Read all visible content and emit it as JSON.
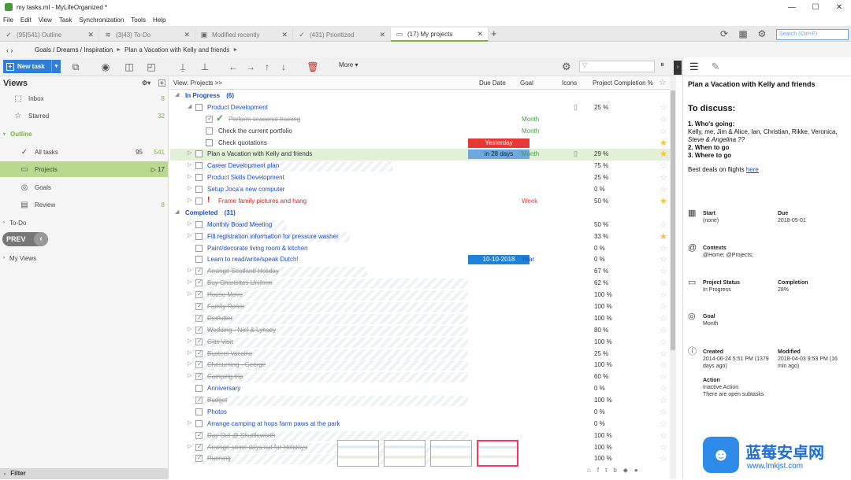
{
  "window": {
    "title": "my tasks.ml - MyLifeOrganized *",
    "buttons": [
      "—",
      "☐",
      "✕"
    ]
  },
  "menu": [
    "File",
    "Edit",
    "View",
    "Task",
    "Synchronization",
    "Tools",
    "Help"
  ],
  "tabs": [
    {
      "label": "(95|541) Outline",
      "icon": "✓"
    },
    {
      "label": "(3|43) To-Do",
      "icon": "≋"
    },
    {
      "label": "Modified recently",
      "icon": "▣"
    },
    {
      "label": "(431) Prioritized",
      "icon": "✓"
    },
    {
      "label": "(17) My projects",
      "icon": "▭"
    }
  ],
  "search": {
    "placeholder": "Search (Ctrl+F)"
  },
  "breadcrumb": {
    "items": [
      "Goals / Dreams / Inspiration",
      "Plan a Vacation with Kelly and friends"
    ]
  },
  "toolbar": {
    "new_task": "New task",
    "more": "More"
  },
  "filter": {
    "placeholder": ""
  },
  "sidebar": {
    "title": "Views",
    "inbox": {
      "label": "Inbox",
      "count": "8"
    },
    "starred": {
      "label": "Starred",
      "count": "32"
    },
    "outline": {
      "label": "Outline"
    },
    "alltasks": {
      "label": "All tasks",
      "count": "95",
      "count2": "541"
    },
    "projects": {
      "label": "Projects",
      "count": "▷ 17"
    },
    "goals": {
      "label": "Goals"
    },
    "review": {
      "label": "Review",
      "count": "8"
    },
    "todo": {
      "label": "To-Do"
    },
    "prev": "PREV",
    "myviews": {
      "label": "My Views"
    },
    "filter": "Filter"
  },
  "grid": {
    "columns": {
      "view": "View: Projects >>",
      "due": "Due Date",
      "goal": "Goal",
      "icons": "Icons",
      "completion": "Project Completion %"
    },
    "groups": {
      "inprogress": "In Progress",
      "inprogress_count": "(6)",
      "completed": "Completed",
      "completed_count": "(31)"
    },
    "rows": [
      {
        "name": "Product Development",
        "goal": "",
        "due": "",
        "pct": "25 %"
      },
      {
        "name": "Perform seasonal training",
        "goal": "Month",
        "due": "",
        "pct": ""
      },
      {
        "name": "Check the current portfolio",
        "goal": "Month",
        "due": "",
        "pct": ""
      },
      {
        "name": "Check quotations",
        "goal": "",
        "due": "Yesterday",
        "pct": ""
      },
      {
        "name": "Plan a Vacation with Kelly and friends",
        "goal": "Month",
        "due": "in 28 days",
        "pct": "29 %"
      },
      {
        "name": "Career Development plan",
        "goal": "",
        "due": "",
        "pct": "75 %"
      },
      {
        "name": "Product Skills Development",
        "goal": "",
        "due": "",
        "pct": "25 %"
      },
      {
        "name": "Setup Joca'a new computer",
        "goal": "",
        "due": "",
        "pct": "0 %"
      },
      {
        "name": "Frame family pictures and hang",
        "goal": "Week",
        "due": "",
        "pct": "50 %"
      },
      {
        "name": "Monthly Board Meeting",
        "goal": "",
        "due": "",
        "pct": "50 %"
      },
      {
        "name": "Fill registration information for pressure washer",
        "goal": "",
        "due": "",
        "pct": "33 %"
      },
      {
        "name": "Paint/decorate living room & kitchen",
        "goal": "",
        "due": "",
        "pct": "0 %"
      },
      {
        "name": "Learn to read/write/speak Dutch!",
        "goal": "Year",
        "due": "10-10-2018",
        "pct": "0 %"
      },
      {
        "name": "Arrange Scotland Holiday",
        "goal": "",
        "due": "",
        "pct": "67 %"
      },
      {
        "name": "Buy Charlottes Uniform",
        "goal": "",
        "due": "",
        "pct": "62 %"
      },
      {
        "name": "House Move",
        "goal": "",
        "due": "",
        "pct": "100 %"
      },
      {
        "name": "Family Room",
        "goal": "",
        "due": "",
        "pct": "100 %"
      },
      {
        "name": "Declutter",
        "goal": "",
        "due": "",
        "pct": "100 %"
      },
      {
        "name": "Wedding - Niel & Lynsey",
        "goal": "",
        "due": "",
        "pct": "80 %"
      },
      {
        "name": "Gills Visit",
        "goal": "",
        "due": "",
        "pct": "100 %"
      },
      {
        "name": "Busters Vaccine",
        "goal": "",
        "due": "",
        "pct": "25 %"
      },
      {
        "name": "Christening - George",
        "goal": "",
        "due": "",
        "pct": "100 %"
      },
      {
        "name": "Camping trip",
        "goal": "",
        "due": "",
        "pct": "60 %"
      },
      {
        "name": "Anniversary",
        "goal": "",
        "due": "",
        "pct": "0 %"
      },
      {
        "name": "Budget",
        "goal": "",
        "due": "",
        "pct": "100 %"
      },
      {
        "name": "Photos",
        "goal": "",
        "due": "",
        "pct": "0 %"
      },
      {
        "name": "Arrange camping at hops farm paws at the park",
        "goal": "",
        "due": "",
        "pct": "0 %"
      },
      {
        "name": "Day Out @ Shuttleworth",
        "goal": "",
        "due": "",
        "pct": "100 %"
      },
      {
        "name": "Arrange some days out for Holidays",
        "goal": "",
        "due": "",
        "pct": "100 %"
      },
      {
        "name": "Running",
        "goal": "",
        "due": "",
        "pct": "100 %"
      }
    ]
  },
  "detail": {
    "title": "Plan a Vacation with Kelly and friends",
    "discuss": "To discuss:",
    "who_h": "1. Who's going:",
    "who_t": "Kelly, me, Jim & Alice, Ian, Christian, Rikke, Veronica,",
    "who_i": "Steve & Angelina ??",
    "when_h": "2. When to go",
    "where_h": "3. Where to go",
    "deals": "Best deals on flights",
    "deals_link": "here",
    "start_l": "Start",
    "start_v": "(none)",
    "due_l": "Due",
    "due_v": "2018-05-01",
    "ctx_l": "Contexts",
    "ctx_v": "@Home; @Projects;",
    "status_l": "Project Status",
    "status_v": "In Progress",
    "comp_l": "Completion",
    "comp_v": "28%",
    "goal_l": "Goal",
    "goal_v": "Month",
    "created_l": "Created",
    "created_v": "2014-06-24 5:51 PM (1379 days ago)",
    "modified_l": "Modified",
    "modified_v": "2018-04-03 9:53 PM (16 min ago)",
    "action_l": "Action",
    "action_v1": "Inactive Action",
    "action_v2": "There are open subtasks"
  },
  "watermark": {
    "logo": "☻",
    "t1": "蓝莓安卓网",
    "t2": "www.lmkjst.com"
  }
}
